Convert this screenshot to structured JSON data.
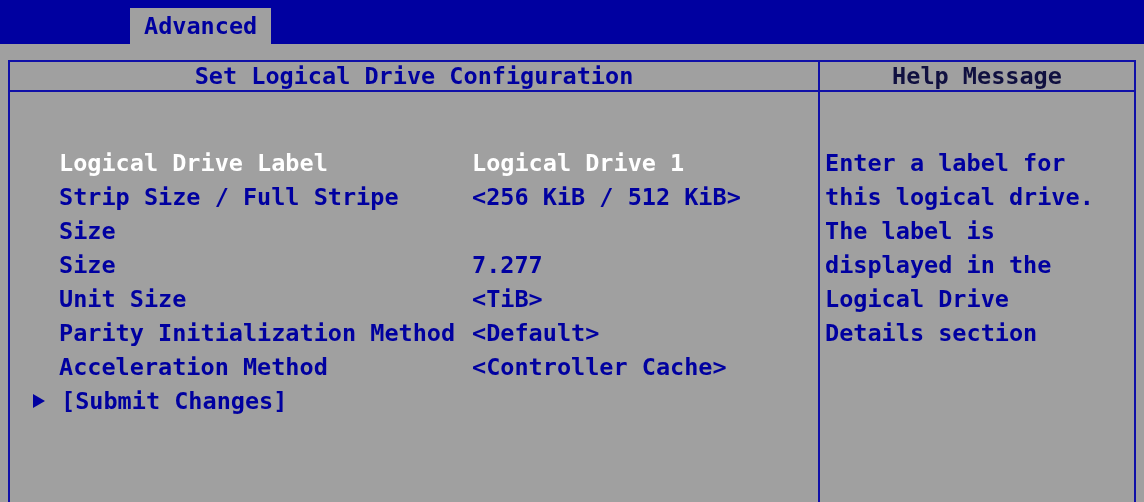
{
  "tabs": [
    {
      "label": "Advanced",
      "selected": true
    }
  ],
  "panel": {
    "title": "Set Logical Drive Configuration",
    "items": [
      {
        "kind": "setting",
        "label": "Logical Drive Label",
        "value": "Logical Drive 1",
        "selected": true
      },
      {
        "kind": "setting",
        "label": "Strip Size / Full Stripe",
        "value": "<256 KiB / 512 KiB>",
        "selected": false
      },
      {
        "kind": "setting",
        "label": "Size",
        "selected": false
      },
      {
        "kind": "setting",
        "label": "Size",
        "value": "7.277",
        "selected": false
      },
      {
        "kind": "setting",
        "label": "Unit Size",
        "value": "<TiB>",
        "selected": false
      },
      {
        "kind": "setting",
        "label": "Parity Initialization Method",
        "value": "<Default>",
        "selected": false
      },
      {
        "kind": "setting",
        "label": "Acceleration Method",
        "value": "<Controller Cache>",
        "selected": false
      },
      {
        "kind": "action",
        "label": "[Submit Changes]",
        "selected": false
      }
    ]
  },
  "help": {
    "title": "Help Message",
    "lines": [
      "Enter a label for",
      "this logical drive.",
      "The label is",
      "displayed in the",
      "Logical Drive",
      "Details section"
    ]
  }
}
